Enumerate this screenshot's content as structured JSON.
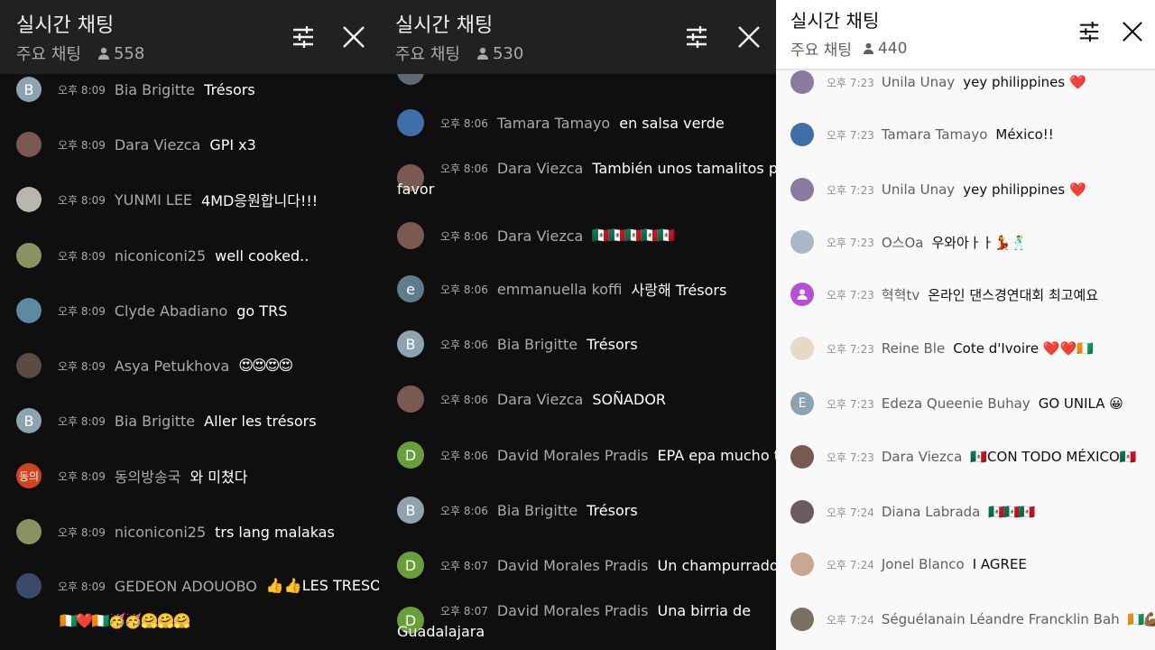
{
  "panel1": {
    "title": "실시간 채팅",
    "subtitle": "주요 채팅",
    "viewers": "558",
    "messages": [
      {
        "avatar_letter": "B",
        "avatar_color": "#8ea3b0",
        "time": "오후 8:09",
        "author": "Bia Brigitte",
        "text": "Trésors"
      },
      {
        "avatar_letter": "",
        "avatar_color": "#7a5a50",
        "time": "오후 8:09",
        "author": "Dara Viezca",
        "text": "GPI x3"
      },
      {
        "avatar_letter": "",
        "avatar_color": "#b9b6ae",
        "time": "오후 8:09",
        "author": "YUNMI LEE",
        "text": "4MD응원합니다!!!"
      },
      {
        "avatar_letter": "",
        "avatar_color": "#8b9160",
        "time": "오후 8:09",
        "author": "niconiconi25",
        "text": "well cooked.."
      },
      {
        "avatar_letter": "",
        "avatar_color": "#5d8aa0",
        "time": "오후 8:09",
        "author": "Clyde Abadiano",
        "text": "go TRS"
      },
      {
        "avatar_letter": "",
        "avatar_color": "#5c4a44",
        "time": "오후 8:09",
        "author": "Asya Petukhova",
        "text": "😍😍😍😍"
      },
      {
        "avatar_letter": "B",
        "avatar_color": "#8ea3b0",
        "time": "오후 8:09",
        "author": "Bia Brigitte",
        "text": "Aller les trésors"
      },
      {
        "avatar_letter": "동의",
        "avatar_color": "#d2421b",
        "time": "오후 8:09",
        "author": "동의방송국",
        "text": "와 미쳤다"
      },
      {
        "avatar_letter": "",
        "avatar_color": "#8b9160",
        "time": "오후 8:09",
        "author": "niconiconi25",
        "text": "trs lang malakas"
      },
      {
        "avatar_letter": "",
        "avatar_color": "#3b4a6a",
        "time": "오후 8:09",
        "author": "GEDEON ADOUOBO",
        "text": "👍👍LES TRESORS",
        "text2": "🇨🇮❤️🇨🇮🥳🥳🤗🤗🤗"
      }
    ]
  },
  "panel2": {
    "title": "실시간 채팅",
    "subtitle": "주요 채팅",
    "viewers": "530",
    "messages": [
      {
        "avatar_letter": "",
        "avatar_color": "#3f6ea8",
        "time": "오후 8:06",
        "author": "Tamara Tamayo",
        "text": "en salsa verde"
      },
      {
        "avatar_letter": "",
        "avatar_color": "#7a5a50",
        "time": "오후 8:06",
        "author": "Dara Viezca",
        "text": "También unos tamalitos por",
        "text2": "favor"
      },
      {
        "avatar_letter": "",
        "avatar_color": "#7a5a50",
        "time": "오후 8:06",
        "author": "Dara Viezca",
        "text": "🇲🇽🇲🇽🇲🇽🇲🇽🇲🇽"
      },
      {
        "avatar_letter": "e",
        "avatar_color": "#5f7c8a",
        "time": "오후 8:06",
        "author": "emmanuella koffi",
        "text": "사랑해 Trésors"
      },
      {
        "avatar_letter": "B",
        "avatar_color": "#8ea3b0",
        "time": "오후 8:06",
        "author": "Bia Brigitte",
        "text": "Trésors"
      },
      {
        "avatar_letter": "",
        "avatar_color": "#7a5a50",
        "time": "오후 8:06",
        "author": "Dara Viezca",
        "text": "SOÑADOR"
      },
      {
        "avatar_letter": "D",
        "avatar_color": "#689f38",
        "time": "오후 8:06",
        "author": "David Morales Pradis",
        "text": "EPA epa mucho texto"
      },
      {
        "avatar_letter": "B",
        "avatar_color": "#8ea3b0",
        "time": "오후 8:06",
        "author": "Bia Brigitte",
        "text": "Trésors"
      },
      {
        "avatar_letter": "D",
        "avatar_color": "#689f38",
        "time": "오후 8:07",
        "author": "David Morales Pradis",
        "text": "Un champurrado"
      },
      {
        "avatar_letter": "D",
        "avatar_color": "#689f38",
        "time": "오후 8:07",
        "author": "David Morales Pradis",
        "text": "Una birria de",
        "text2": "Guadalajara"
      }
    ]
  },
  "panel3": {
    "title": "실시간 채팅",
    "subtitle": "주요 채팅",
    "viewers": "440",
    "messages": [
      {
        "avatar_letter": "",
        "avatar_color": "#8a7aa0",
        "time": "오후 7:23",
        "author": "Unila Unay",
        "text": "yey philippines ❤️"
      },
      {
        "avatar_letter": "",
        "avatar_color": "#3f6ea8",
        "time": "오후 7:23",
        "author": "Tamara Tamayo",
        "text": "México!!"
      },
      {
        "avatar_letter": "",
        "avatar_color": "#8a7aa0",
        "time": "오후 7:23",
        "author": "Unila Unay",
        "text": "yey philippines ❤️"
      },
      {
        "avatar_letter": "",
        "avatar_color": "#a8b8c8",
        "time": "오후 7:23",
        "author": "O스Oa",
        "text": "우와아ㅏㅏ💃🕺"
      },
      {
        "avatar_letter": "",
        "avatar_color": "#b74fd6",
        "time": "오후 7:23",
        "author": "혁혁tv",
        "text": "온라인 댄스경연대회 최고예요"
      },
      {
        "avatar_letter": "",
        "avatar_color": "#e8d8c8",
        "time": "오후 7:23",
        "author": "Reine Ble",
        "text": "Cote d'Ivoire ❤️❤️🇨🇮"
      },
      {
        "avatar_letter": "E",
        "avatar_color": "#8ea3b0",
        "time": "오후 7:23",
        "author": "Edeza Queenie Buhay",
        "text": "GO UNILA 😀"
      },
      {
        "avatar_letter": "",
        "avatar_color": "#7a5a50",
        "time": "오후 7:23",
        "author": "Dara Viezca",
        "text": "🇲🇽CON TODO MÉXICO🇲🇽"
      },
      {
        "avatar_letter": "",
        "avatar_color": "#6a5a62",
        "time": "오후 7:24",
        "author": "Diana Labrada",
        "text": "🇲🇽🇲🇽🇲🇽"
      },
      {
        "avatar_letter": "",
        "avatar_color": "#c8a890",
        "time": "오후 7:24",
        "author": "Jonel Blanco",
        "text": "I AGREE"
      },
      {
        "avatar_letter": "",
        "avatar_color": "#7a7060",
        "time": "오후 7:24",
        "author": "Séguélanain Léandre Francklin Bah",
        "text": "🇨🇮💪🏾🇨🇮"
      }
    ]
  }
}
